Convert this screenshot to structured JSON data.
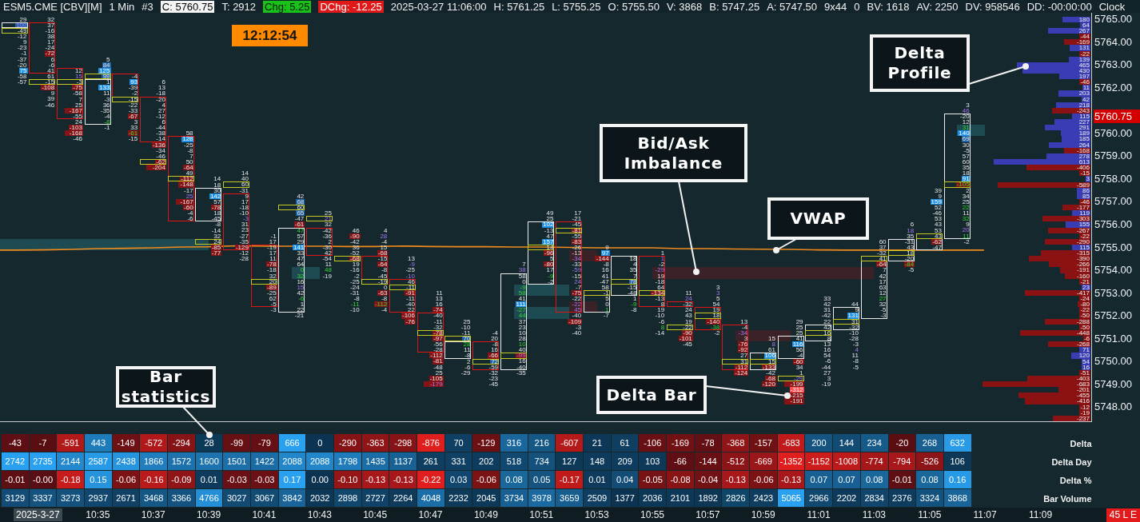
{
  "header": {
    "items": [
      {
        "text": "ESM5.CME [CBV][M]",
        "kind": "plain"
      },
      {
        "text": "1 Min",
        "kind": "plain"
      },
      {
        "text": "#3",
        "kind": "plain"
      },
      {
        "text": "C: 5760.75",
        "kind": "boxed"
      },
      {
        "text": "T: 2912",
        "kind": "plain"
      },
      {
        "text": "Chg: 5.25",
        "kind": "up"
      },
      {
        "text": "DChg: -12.25",
        "kind": "down"
      },
      {
        "text": "2025-03-27 11:06:00",
        "kind": "plain"
      },
      {
        "text": "H: 5761.25",
        "kind": "plain"
      },
      {
        "text": "L: 5755.25",
        "kind": "plain"
      },
      {
        "text": "O: 5755.50",
        "kind": "plain"
      },
      {
        "text": "V: 3868",
        "kind": "plain"
      },
      {
        "text": "B: 5747.25",
        "kind": "plain"
      },
      {
        "text": "A: 5747.50",
        "kind": "plain"
      },
      {
        "text": "9x44",
        "kind": "plain"
      },
      {
        "text": "0",
        "kind": "plain"
      },
      {
        "text": "BV: 1618",
        "kind": "plain"
      },
      {
        "text": "AV: 2250",
        "kind": "plain"
      },
      {
        "text": "DV: 958546",
        "kind": "plain"
      },
      {
        "text": "DD: -00:00:00",
        "kind": "plain"
      },
      {
        "text": "Clock",
        "kind": "plain"
      }
    ]
  },
  "clock": "12:12:54",
  "footprint": {
    "bars": [
      {
        "kind": "up",
        "above": [
          "29"
        ],
        "body": [
          {
            "value": "100",
            "kind": "sell"
          }
        ],
        "below": [
          {
            "value": "-49",
            "kind": "poc"
          },
          "-12",
          "9",
          "-23",
          "-1",
          "-37",
          "-20",
          {
            "value": "75",
            "kind": "ask"
          },
          "-58",
          "-57"
        ]
      },
      {
        "kind": "down",
        "above": [
          "32"
        ],
        "body": [
          "37",
          "-16",
          "38",
          "17",
          "-24",
          "-72",
          "6",
          "-6",
          "41"
        ],
        "below": [
          "61",
          {
            "value": "-15",
            "kind": "poc"
          },
          "-108",
          "9",
          "39",
          "-46"
        ]
      },
      {
        "kind": "down",
        "body": [
          "12",
          {
            "value": "15",
            "kind": "sell"
          },
          {
            "value": "-3",
            "kind": "poc"
          },
          "-75",
          "-58",
          "7",
          "25",
          "-167",
          "-55"
        ],
        "below": [
          "24",
          "-103",
          "-168",
          "-46"
        ]
      },
      {
        "kind": "up",
        "above": [
          "5",
          "84",
          {
            "value": "125",
            "kind": "ask"
          },
          {
            "value": "99",
            "kind": "poc"
          }
        ],
        "body": [
          "1",
          {
            "value": "133",
            "kind": "ask"
          },
          "11",
          "-3",
          "36",
          "-35",
          "-4",
          {
            "value": "-8",
            "kind": "buy"
          }
        ],
        "below": [
          "-1"
        ]
      },
      {
        "kind": "down",
        "body": [
          "-4",
          {
            "value": "93",
            "kind": "ask"
          },
          "-39",
          "-2",
          {
            "value": "-15",
            "kind": "poc"
          }
        ],
        "below": [
          "-22",
          "-33",
          "-67",
          "3",
          "33",
          {
            "value": "-61",
            "kind": "buy"
          },
          "-15"
        ]
      },
      {
        "kind": "down",
        "above": [
          "6",
          "13",
          "-18"
        ],
        "body": [
          "-20",
          "4",
          "27",
          "-12",
          "6",
          "-44",
          "-38",
          "-14"
        ],
        "below": [
          "-136",
          "-34",
          "-46",
          {
            "value": "-62",
            "kind": "poc"
          },
          "-204"
        ]
      },
      {
        "kind": "down",
        "above": [
          "58"
        ],
        "body": [
          {
            "value": "128",
            "kind": "ask"
          },
          "-25",
          "-8",
          "7",
          "50",
          "-64",
          "49",
          {
            "value": "-112",
            "kind": "poc"
          },
          "-148",
          "-17",
          {
            "value": "25",
            "kind": "sell"
          },
          "-167",
          "-60",
          "-4",
          "-6"
        ]
      },
      {
        "kind": "up",
        "above": [
          "14",
          "18"
        ],
        "body": [
          "30",
          {
            "value": "142",
            "kind": "ask"
          },
          "57",
          "-78",
          "18",
          "-45"
        ],
        "below": [
          "-8",
          "-14",
          "32",
          {
            "value": "24",
            "kind": "poc"
          },
          "-85",
          "-77"
        ]
      },
      {
        "kind": "down",
        "above": [
          "14",
          "40",
          {
            "value": "60",
            "kind": "poc"
          },
          "-31"
        ],
        "body": [
          "9",
          "17",
          "-18",
          "-10",
          {
            "value": "-3",
            "kind": "sell"
          },
          "31",
          "23",
          "-27",
          "-35",
          "-129"
        ],
        "below": [
          "-12",
          "-28"
        ]
      },
      {
        "kind": "down",
        "above": [
          "-1",
          "17"
        ],
        "body": [
          "-19",
          "17",
          "11",
          "-78",
          "-18",
          "32",
          {
            "value": "20",
            "kind": "poc"
          },
          "-89",
          "-25",
          "62",
          "-5"
        ],
        "below": [
          "-3"
        ]
      },
      {
        "kind": "up",
        "above": [
          "42",
          "68",
          {
            "value": "60",
            "kind": "poc"
          },
          "65",
          "-47",
          "-61"
        ],
        "body": [
          {
            "value": "47",
            "kind": "buy"
          },
          "57",
          "29",
          {
            "value": "141",
            "kind": "ask"
          },
          "33",
          "47",
          "64",
          {
            "value": "0",
            "kind": "buy"
          },
          {
            "value": "32",
            "kind": "buy"
          },
          "16",
          {
            "value": "15",
            "kind": "sell"
          },
          "42",
          {
            "value": "-6",
            "kind": "buy"
          },
          "1",
          "22"
        ],
        "below": [
          "-21"
        ]
      },
      {
        "kind": "down",
        "above": [
          "25",
          {
            "value": "21",
            "kind": "poc_sell"
          },
          "32"
        ],
        "body": [
          "-42",
          "-36",
          "2",
          "-30",
          "42"
        ],
        "below": [
          "-54",
          "11",
          {
            "value": "48",
            "kind": "buy"
          },
          "-19"
        ]
      },
      {
        "kind": "down",
        "above": [
          "46",
          "-90",
          "-42",
          "36",
          "-52"
        ],
        "body": [
          {
            "value": "-68",
            "kind": "poc"
          }
        ],
        "below": [
          "19",
          "-16",
          "-2",
          "-25",
          "-24",
          "-31",
          "-8",
          {
            "value": "-11",
            "kind": "buy"
          },
          "-10"
        ]
      },
      {
        "kind": "down",
        "above": [
          "4",
          {
            "value": "28",
            "kind": "sell"
          },
          "-4",
          "15",
          "-68"
        ],
        "body": [
          "-15",
          "-64",
          "-8",
          "-45",
          {
            "value": "-19",
            "kind": "poc"
          }
        ],
        "below": [
          "0",
          "-63",
          "-8",
          {
            "value": "-112",
            "kind": "buy"
          },
          "-4"
        ]
      },
      {
        "kind": "down",
        "above": [
          "13",
          {
            "value": "-9",
            "kind": "sell"
          },
          "-25",
          {
            "value": "-10",
            "kind": "sell"
          }
        ],
        "body": [
          "46",
          {
            "value": "-11",
            "kind": "poc"
          },
          "-91",
          "-11",
          "-40",
          "22"
        ],
        "below": [
          "-106",
          "-76"
        ]
      },
      {
        "kind": "down",
        "above": [
          "11",
          "13",
          "16",
          "-74"
        ],
        "body": [
          "-40",
          "-11",
          "-32",
          {
            "value": "-78",
            "kind": "poc"
          },
          "-97",
          "-56",
          "-28"
        ],
        "below": [
          "-112",
          "-81",
          "-48",
          "25",
          "-105",
          {
            "value": "-179",
            "kind": "sell"
          }
        ]
      },
      {
        "kind": "up",
        "above": [
          "25",
          "-10",
          "-11",
          {
            "value": "70",
            "kind": "poc"
          }
        ],
        "body": [
          {
            "value": "28",
            "kind": "buy"
          },
          "11",
          "-8"
        ],
        "below": [
          "2",
          "-6",
          "-29"
        ]
      },
      {
        "kind": "down",
        "above": [
          "-4",
          "20"
        ],
        "body": [
          "-8",
          "16",
          "-66",
          {
            "value": "72",
            "kind": "poc"
          },
          "-59"
        ],
        "below": [
          "-32",
          "-23",
          "-45"
        ]
      },
      {
        "kind": "up",
        "above": [
          "7",
          {
            "value": "38",
            "kind": "sell"
          }
        ],
        "body": [
          "58",
          "0",
          {
            "value": "-9",
            "kind": "buy"
          },
          {
            "value": "58",
            "kind": "buy"
          },
          "41",
          {
            "value": "111",
            "kind": "ask"
          },
          {
            "value": "-27",
            "kind": "buy"
          },
          {
            "value": "44",
            "kind": "buy"
          },
          "37",
          "23",
          "10",
          "28",
          {
            "value": "10",
            "kind": "buy"
          },
          "40",
          {
            "value": "-99",
            "kind": "poc_sell"
          },
          "16",
          "-40"
        ],
        "below": [
          "-35"
        ]
      },
      {
        "kind": "up",
        "above": [
          "49",
          "25"
        ],
        "body": [
          {
            "value": "102",
            "kind": "ask"
          },
          "-13",
          "47",
          {
            "value": "157",
            "kind": "ask"
          },
          {
            "value": "14",
            "kind": "poc"
          },
          "-96",
          "5",
          "-80",
          "17",
          {
            "value": "-9",
            "kind": "buy"
          },
          "-2"
        ]
      },
      {
        "kind": "down",
        "above": [
          "17",
          "-21"
        ],
        "body": [
          "-45",
          {
            "value": "-81",
            "kind": "poc"
          },
          "-55",
          "-83",
          "-26",
          "-13",
          {
            "value": "-34",
            "kind": "sell"
          },
          "-33",
          {
            "value": "-59",
            "kind": "sell"
          },
          "-15",
          {
            "value": "24",
            "kind": "sell"
          },
          "-7",
          "-75",
          "-22",
          {
            "value": "-22",
            "kind": "sell"
          },
          {
            "value": "45",
            "kind": "sell"
          }
        ],
        "below": [
          "-40",
          "-109",
          "-3",
          "-40"
        ]
      },
      {
        "kind": "up",
        "above": [
          "9",
          {
            "value": "97",
            "kind": "ask"
          },
          "-144",
          "-8",
          "16",
          "41",
          "-47",
          "58"
        ],
        "body": [
          {
            "value": "-1",
            "kind": "poc"
          },
          "5",
          "0",
          {
            "value": "1",
            "kind": "buy"
          }
        ],
        "below": [
          "-7"
        ]
      },
      {
        "kind": "up",
        "body": [
          "18",
          "4",
          "35",
          "7",
          {
            "value": "78",
            "kind": "poc"
          },
          "-15",
          "-48"
        ],
        "below": [
          "1",
          {
            "value": "-9",
            "kind": "buy"
          },
          "-8"
        ]
      },
      {
        "kind": "down",
        "above": [
          "1"
        ],
        "body": [
          {
            "value": "1",
            "kind": "sell"
          },
          "-2",
          {
            "value": "-29",
            "kind": "sell"
          },
          "19",
          "-18",
          "64",
          {
            "value": "-134",
            "kind": "poc"
          },
          "-13",
          "8"
        ],
        "below": [
          "19",
          "-10",
          "-6",
          {
            "value": "8",
            "kind": "buy"
          },
          "-14"
        ]
      },
      {
        "kind": "down",
        "above": [
          "11",
          {
            "value": "24",
            "kind": "sell"
          }
        ],
        "body": [
          "-32"
        ],
        "below": [
          "24",
          "43",
          "19",
          {
            "value": "-22",
            "kind": "poc"
          },
          "-90",
          "-101",
          "-45"
        ]
      },
      {
        "kind": "down",
        "above": [
          "3",
          {
            "value": "3",
            "kind": "sell"
          },
          "5",
          "54"
        ],
        "body": [
          "19",
          {
            "value": "18",
            "kind": "poc"
          },
          "-140",
          {
            "value": "-38",
            "kind": "buy"
          }
        ],
        "below": [
          "-2"
        ]
      },
      {
        "kind": "down",
        "above": [
          "13"
        ],
        "body": [
          "-4",
          {
            "value": "-34",
            "kind": "sell"
          },
          "3",
          "-76",
          "-92",
          "27",
          {
            "value": "31",
            "kind": "poc"
          },
          "-112"
        ],
        "below": [
          "-124"
        ]
      },
      {
        "kind": "up",
        "above": [
          "15",
          {
            "value": "8",
            "kind": "sell"
          },
          "61"
        ],
        "body": [
          {
            "value": "106",
            "kind": "ask"
          },
          {
            "value": "15",
            "kind": "poc"
          },
          "-133"
        ],
        "below": [
          "-42",
          "-68",
          "-120"
        ]
      },
      {
        "kind": "up",
        "above": [
          "29",
          "25",
          "25"
        ],
        "body": [
          "41",
          {
            "value": "116",
            "kind": "ask"
          },
          "56",
          "-4"
        ],
        "below": [
          "-60",
          "34",
          "1",
          {
            "value": "-29",
            "kind": "poc_sell"
          },
          "-199",
          {
            "value": "-312",
            "kind": "bid"
          },
          "-215",
          "-191"
        ]
      },
      {
        "kind": "up",
        "above": [
          "33",
          "42",
          "31",
          "-42",
          "22"
        ],
        "body": [
          "42",
          {
            "value": "16",
            "kind": "poc"
          },
          "8"
        ],
        "below": [
          "13",
          "16",
          "54",
          "-6",
          "-44",
          "27",
          "3",
          "-19"
        ]
      },
      {
        "kind": "up",
        "above": [
          "44"
        ],
        "body": [
          "9",
          {
            "value": "131",
            "kind": "ask"
          },
          {
            "value": "31",
            "kind": "poc"
          },
          "-32"
        ],
        "below": [
          "-10",
          "-28",
          "-3",
          {
            "value": "4",
            "kind": "sell"
          },
          "11",
          "-8",
          "-5"
        ]
      },
      {
        "kind": "up",
        "above": [
          "60",
          "37",
          "-32"
        ],
        "body": [
          {
            "value": "41",
            "kind": "poc"
          },
          "-64",
          "7",
          "42",
          "17",
          "63",
          "12",
          {
            "value": "27",
            "kind": "buy"
          },
          "32",
          "-5",
          "-3"
        ]
      },
      {
        "kind": "up",
        "above": [
          "6",
          {
            "value": "18",
            "kind": "sell"
          },
          "35"
        ],
        "body": [
          "-31",
          "43",
          {
            "value": "18",
            "kind": "poc"
          },
          "-20"
        ],
        "below": [
          {
            "value": "-84",
            "kind": "buy"
          },
          "-5"
        ]
      },
      {
        "kind": "up",
        "above": [
          "39",
          "9",
          {
            "value": "159",
            "kind": "ask"
          },
          "52",
          "-46",
          "53",
          "43",
          "53"
        ],
        "body": [
          {
            "value": "43",
            "kind": "poc"
          },
          "-62",
          "-47"
        ]
      },
      {
        "kind": "up",
        "above": [
          "3",
          {
            "value": "46",
            "kind": "sell"
          }
        ],
        "body": [
          "-20",
          "12",
          {
            "value": "31",
            "kind": "buy"
          },
          {
            "value": "140",
            "kind": "ask"
          },
          "69",
          "30",
          "-5",
          "57",
          "60",
          "35",
          "18",
          {
            "value": "91",
            "kind": "ask"
          },
          {
            "value": "-105",
            "kind": "poc_buy"
          },
          "2",
          "34",
          "25",
          {
            "value": "22",
            "kind": "buy"
          },
          "11",
          {
            "value": "32",
            "kind": "buy"
          },
          "9",
          {
            "value": "20",
            "kind": "sell"
          },
          {
            "value": "11",
            "kind": "buy"
          }
        ],
        "below": [
          "-2"
        ]
      }
    ],
    "imbalance_zones": [
      {
        "kind": "ask"
      },
      {
        "kind": "ask"
      },
      {
        "kind": "ask"
      },
      {
        "kind": "ask"
      },
      {
        "kind": "bid"
      },
      {
        "kind": "bid"
      },
      {
        "kind": "bid"
      },
      {
        "kind": "bid"
      },
      {
        "kind": "ask"
      }
    ]
  },
  "delta_profile": {
    "rows": [
      "180",
      "64",
      "267",
      "-44",
      "-169",
      "131",
      "-22",
      "139",
      "465",
      "430",
      "197",
      "-46",
      "11",
      "203",
      "42",
      "218",
      "-243",
      "115",
      "227",
      "291",
      "189",
      "185",
      "264",
      "-168",
      "278",
      "613",
      "-406",
      "-15",
      "3",
      "-589",
      "86",
      "85",
      "-46",
      "-177",
      "119",
      "-303",
      "155",
      "-267",
      "-22",
      "-290",
      "115",
      "-315",
      "-390",
      "-266",
      "-191",
      "-160",
      "-21",
      "23",
      "-417",
      "-24",
      "-80",
      "-22",
      "-50",
      "-288",
      "-50",
      "-448",
      "-6",
      "-268",
      "71",
      "120",
      "54",
      "16",
      "-51",
      "-403",
      "-683",
      "-201",
      "-455",
      "-416",
      "-12",
      "-19",
      "-237"
    ]
  },
  "price_axis": {
    "labels": [
      "5765.00",
      "5764.00",
      "5763.00",
      "5762.00",
      "5760.00",
      "5759.00",
      "5758.00",
      "5757.00",
      "5756.00",
      "5755.00",
      "5754.00",
      "5753.00",
      "5752.00",
      "5751.00",
      "5750.00",
      "5749.00",
      "5748.00"
    ],
    "current_price": "5760.75"
  },
  "callouts": [
    "Delta Profile",
    "Bid/Ask Imbalance",
    "VWAP",
    "Bar statistics",
    "Delta Bar"
  ],
  "bar_statistics": {
    "rows": [
      {
        "label": "Delta",
        "kind": "delta",
        "cells": [
          "-43",
          "-7",
          "-591",
          "443",
          "-149",
          "-572",
          "-294",
          "28",
          "-99",
          "-79",
          "666",
          "0",
          "-290",
          "-363",
          "-298",
          "-876",
          "70",
          "-129",
          "316",
          "216",
          "-607",
          "21",
          "61",
          "-106",
          "-169",
          "-78",
          "-368",
          "-157",
          "-683",
          "200",
          "144",
          "234",
          "-20",
          "268",
          "632"
        ]
      },
      {
        "label": "Delta Day",
        "kind": "delta",
        "cells": [
          "2742",
          "2735",
          "2144",
          "2587",
          "2438",
          "1866",
          "1572",
          "1600",
          "1501",
          "1422",
          "2088",
          "2088",
          "1798",
          "1435",
          "1137",
          "261",
          "331",
          "202",
          "518",
          "734",
          "127",
          "148",
          "209",
          "103",
          "-66",
          "-144",
          "-512",
          "-669",
          "-1352",
          "-1152",
          "-1008",
          "-774",
          "-794",
          "-526",
          "106"
        ]
      },
      {
        "label": "Delta %",
        "kind": "delta",
        "cells": [
          "-0.01",
          "-0.00",
          "-0.18",
          "0.15",
          "-0.06",
          "-0.16",
          "-0.09",
          "0.01",
          "-0.03",
          "-0.03",
          "0.17",
          "0.00",
          "-0.10",
          "-0.13",
          "-0.13",
          "-0.22",
          "0.03",
          "-0.06",
          "0.08",
          "0.05",
          "-0.17",
          "0.01",
          "0.04",
          "-0.05",
          "-0.08",
          "-0.04",
          "-0.13",
          "-0.06",
          "-0.13",
          "0.07",
          "0.07",
          "0.08",
          "-0.01",
          "0.08",
          "0.16"
        ]
      },
      {
        "label": "Bar Volume",
        "kind": "volume",
        "cells": [
          "3129",
          "3337",
          "3273",
          "2937",
          "2671",
          "3468",
          "3366",
          "4766",
          "3027",
          "3067",
          "3842",
          "2032",
          "2898",
          "2727",
          "2264",
          "4048",
          "2232",
          "2045",
          "3734",
          "3978",
          "3659",
          "2509",
          "1377",
          "2036",
          "2101",
          "1892",
          "2826",
          "2423",
          "5065",
          "2966",
          "2202",
          "2834",
          "2376",
          "3324",
          "3868"
        ]
      }
    ]
  },
  "time_axis": {
    "date": "2025-3-27",
    "labels": [
      "10:35",
      "10:37",
      "10:39",
      "10:41",
      "10:43",
      "10:45",
      "10:47",
      "10:49",
      "10:51",
      "10:53",
      "10:55",
      "10:57",
      "10:59",
      "11:01",
      "11:03",
      "11:05",
      "11:07",
      "11:09"
    ],
    "status": "45 L E"
  }
}
